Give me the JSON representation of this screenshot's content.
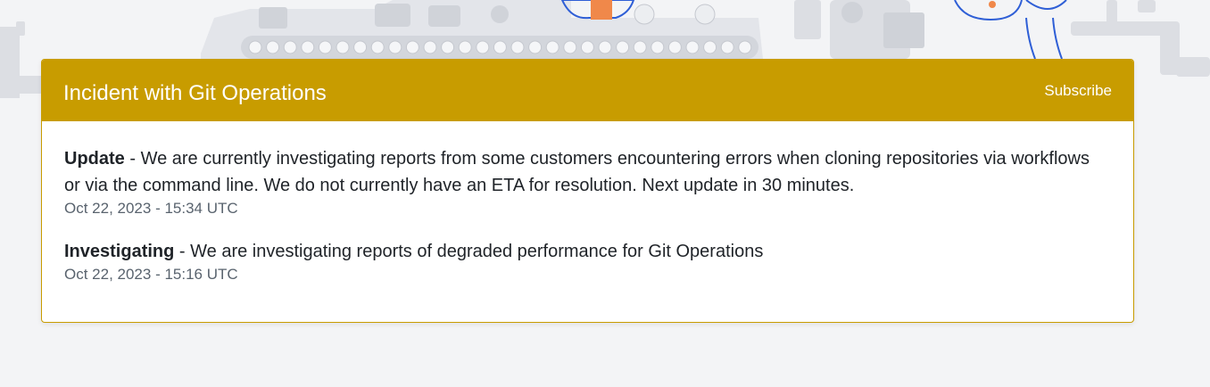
{
  "incident": {
    "title": "Incident with Git Operations",
    "subscribe_label": "Subscribe",
    "updates": [
      {
        "status": "Update",
        "separator": " - ",
        "message": "We are currently investigating reports from some customers encountering errors when cloning repositories via workflows or via the command line. We do not currently have an ETA for resolution. Next update in 30 minutes.",
        "timestamp": "Oct 22, 2023 - 15:34 UTC"
      },
      {
        "status": "Investigating",
        "separator": " - ",
        "message": "We are investigating reports of degraded performance for Git Operations",
        "timestamp": "Oct 22, 2023 - 15:16 UTC"
      }
    ]
  },
  "colors": {
    "header_bg": "#c89c00",
    "page_bg": "#f3f4f6",
    "timestamp": "#59636e",
    "illustration_grey": "#d9dbe0",
    "illustration_blue": "#2f5fd6",
    "illustration_orange": "#f0884a"
  }
}
